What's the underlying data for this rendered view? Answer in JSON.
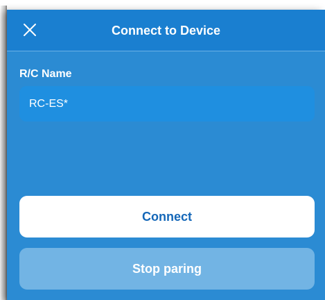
{
  "header": {
    "title": "Connect to Device",
    "close_icon": "close-icon"
  },
  "form": {
    "label": "R/C Name",
    "value": "RC-ES*"
  },
  "buttons": {
    "connect_label": "Connect",
    "stop_label": "Stop paring"
  },
  "colors": {
    "panel": "#2b8bd3",
    "header": "#1a7fd0",
    "field": "#1f8fe0",
    "primary_button": "#ffffff",
    "primary_text": "#1467b8",
    "disabled_button": "#72b4e4"
  }
}
